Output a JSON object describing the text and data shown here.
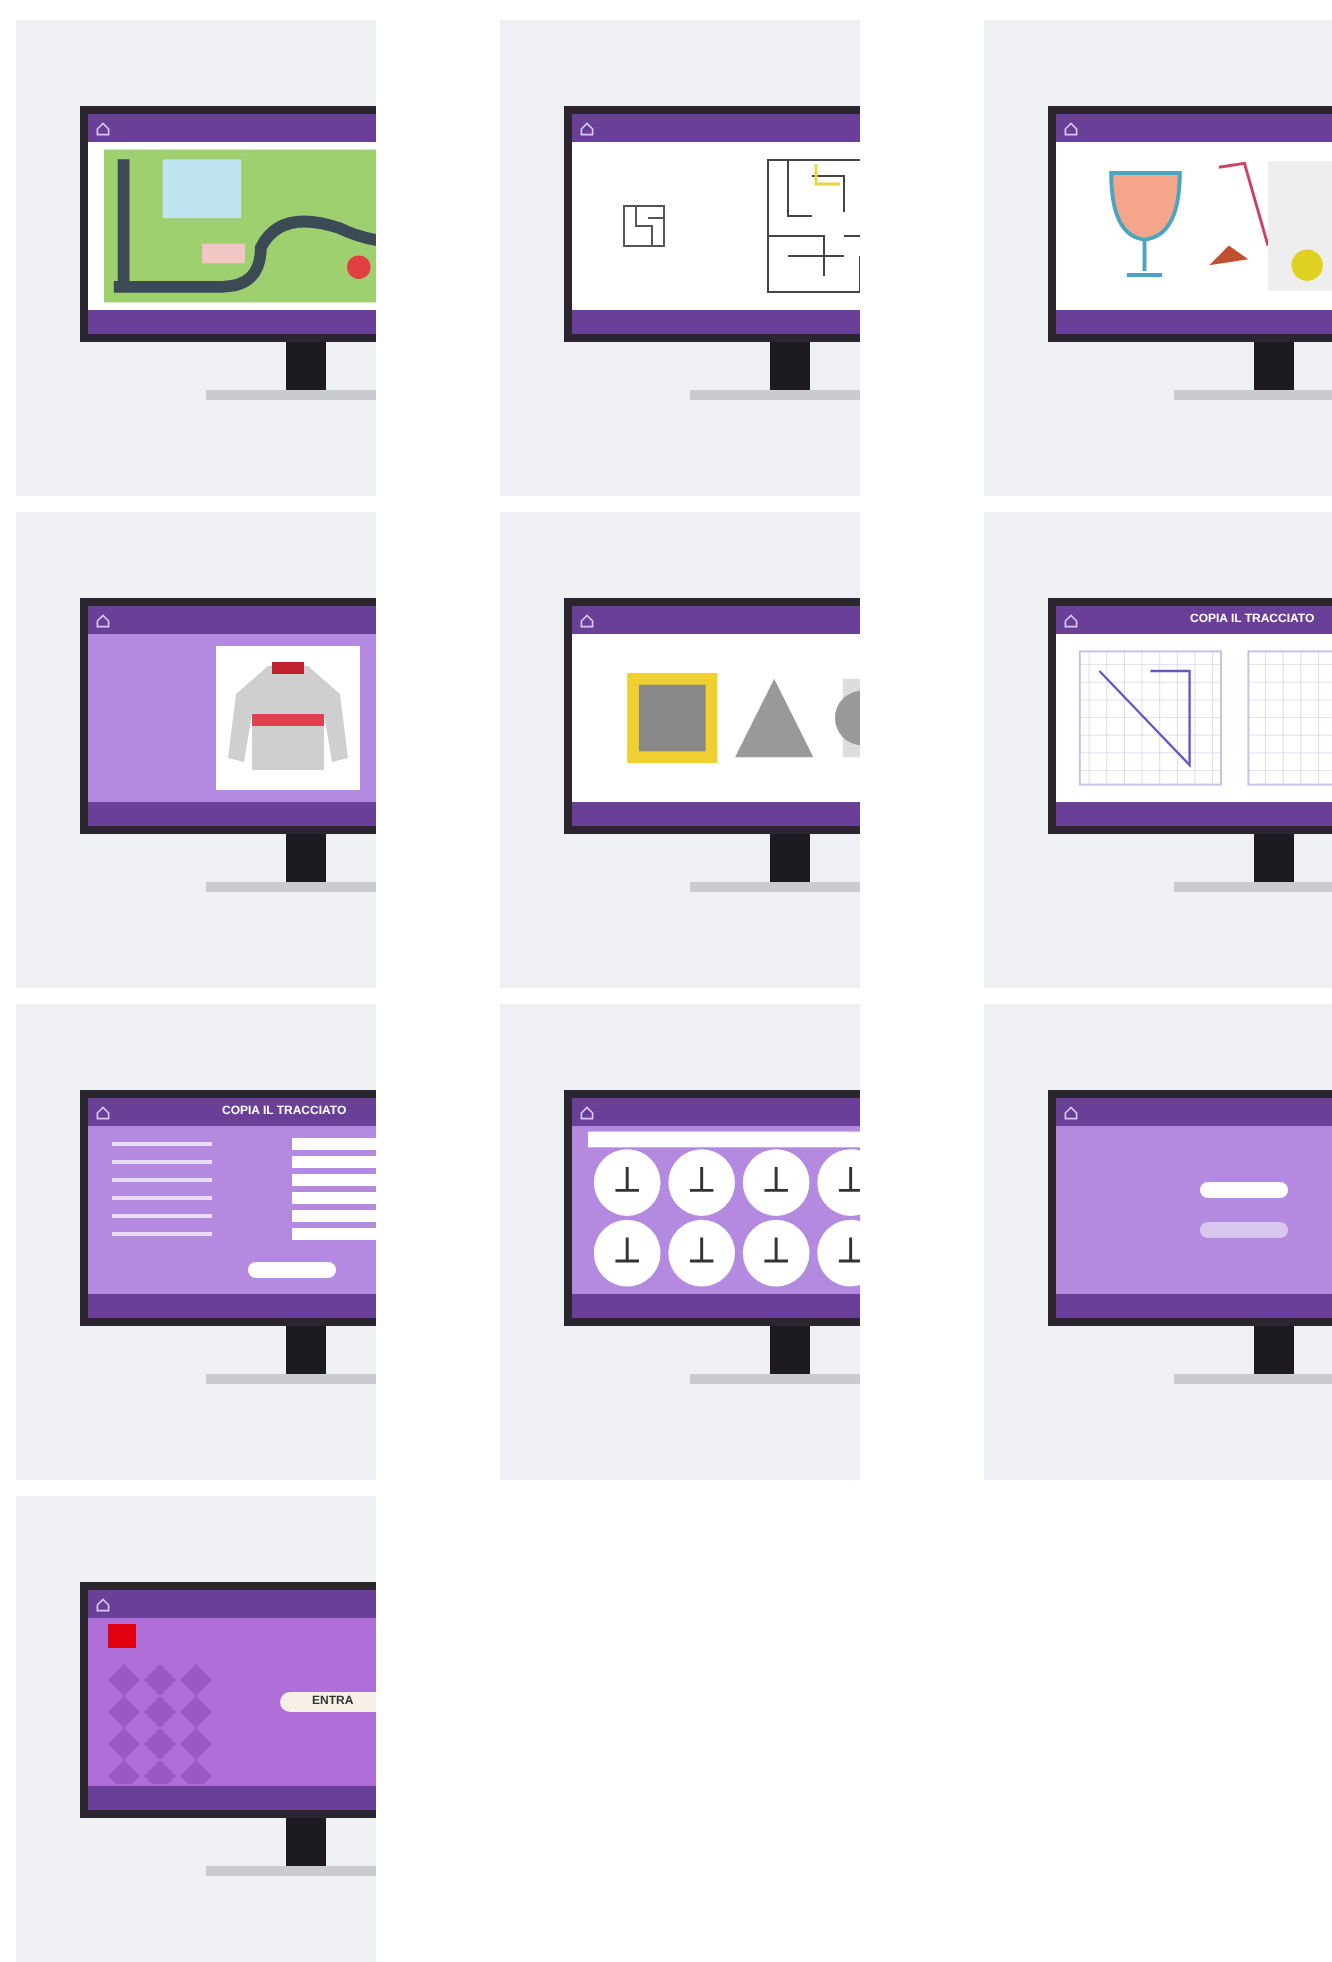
{
  "tiles": [
    {
      "kind": "map"
    },
    {
      "kind": "maze"
    },
    {
      "kind": "objects"
    },
    {
      "kind": "sweater"
    },
    {
      "kind": "shapes"
    },
    {
      "kind": "grid",
      "title": "COPIA IL TRACCIATO"
    },
    {
      "kind": "form",
      "title": "COPIA IL TRACCIATO"
    },
    {
      "kind": "icons"
    },
    {
      "kind": "profile"
    },
    {
      "kind": "intro",
      "button": "ENTRA"
    }
  ]
}
